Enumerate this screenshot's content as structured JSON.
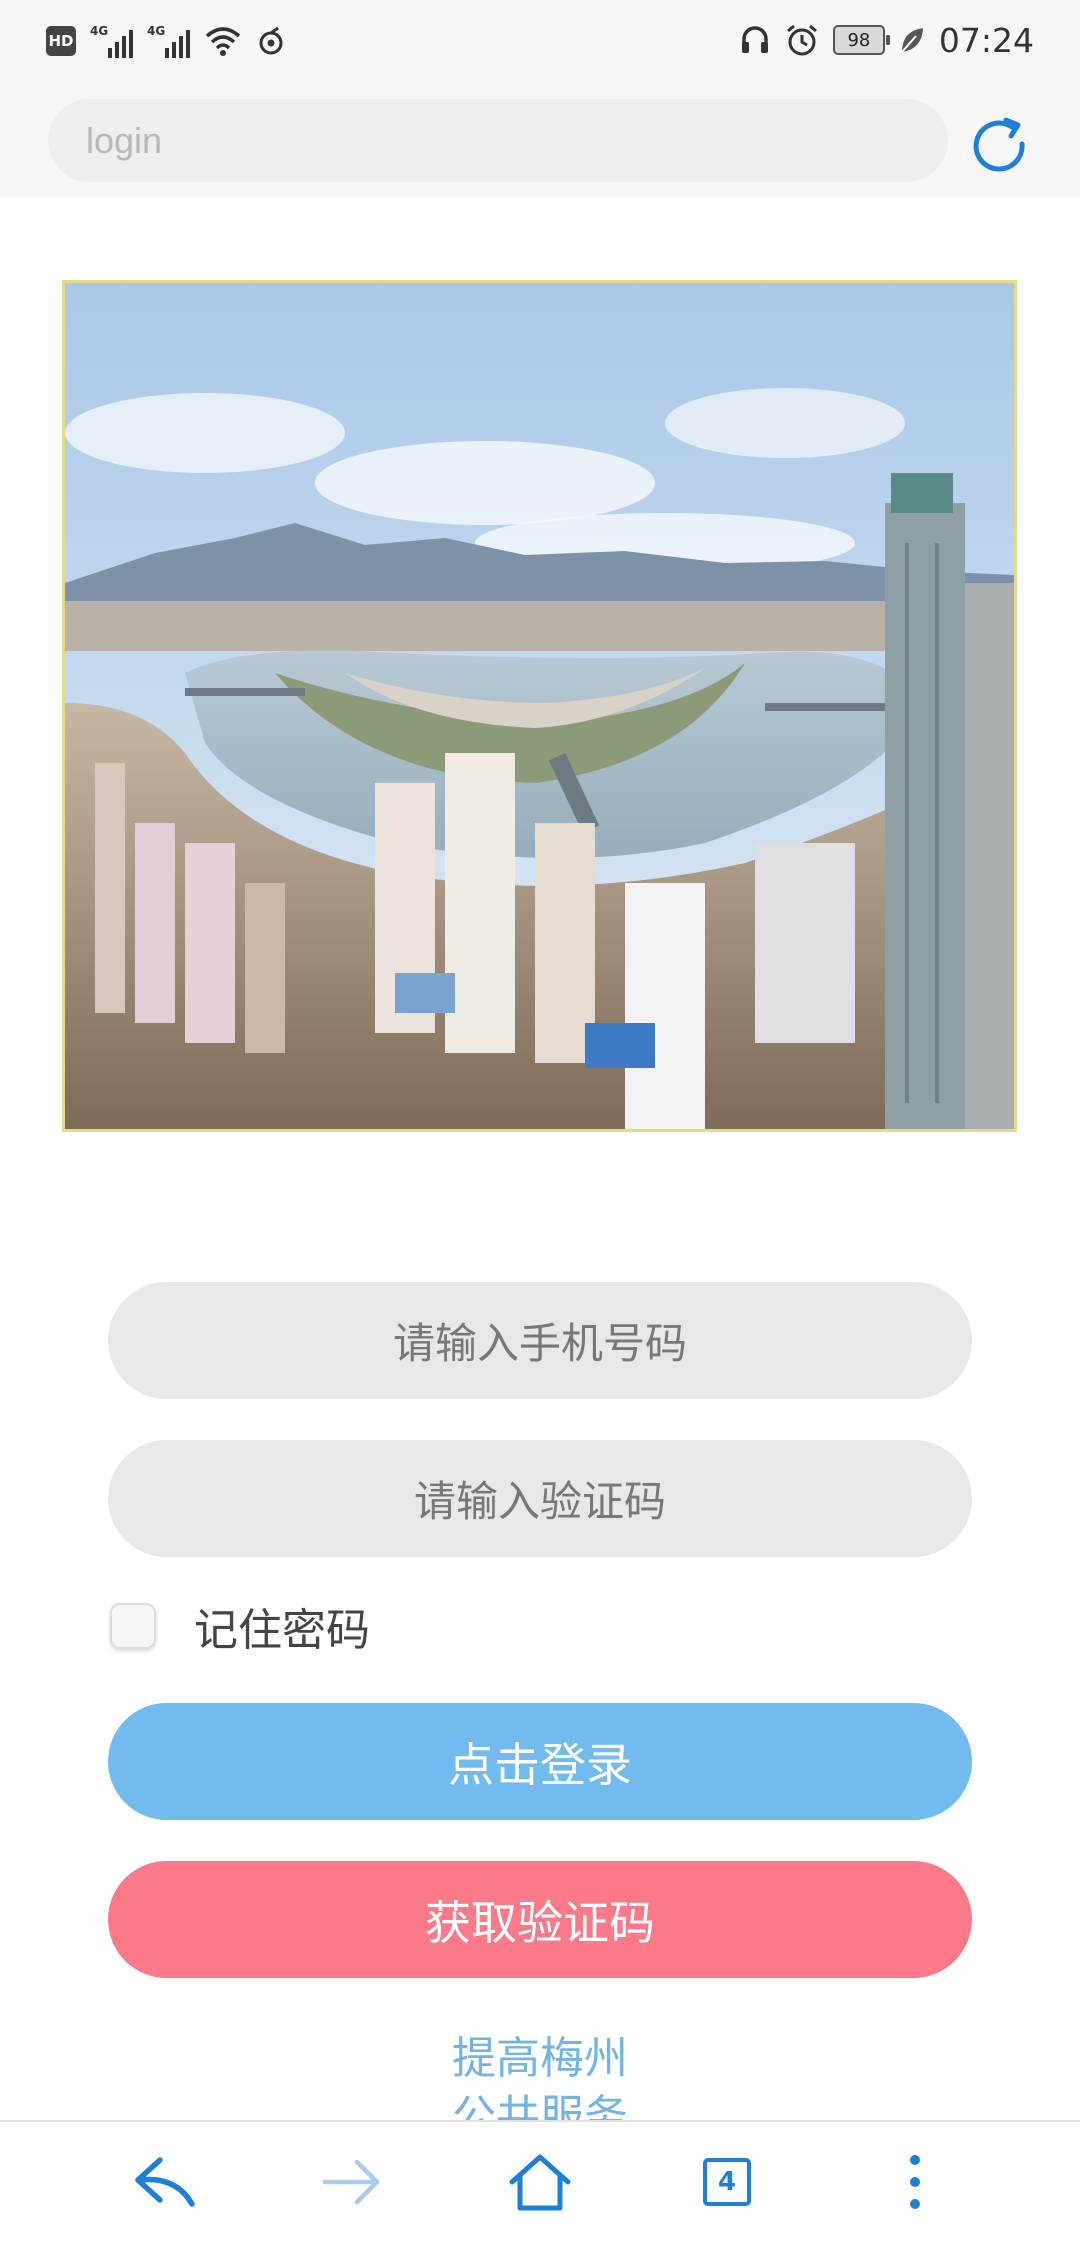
{
  "status_bar": {
    "hd_label": "HD",
    "network_1": "4G",
    "network_2": "4G",
    "battery_level": "98",
    "time": "07:24"
  },
  "browser": {
    "url_placeholder": "login",
    "reload_icon": "reload-icon",
    "accent_color": "#1d7fd8"
  },
  "hero_image": {
    "description_icon": "city-river-panorama-image"
  },
  "form": {
    "phone_placeholder": "请输入手机号码",
    "code_placeholder": "请输入验证码",
    "remember_label": "记住密码",
    "remember_checked": false,
    "login_button": "点击登录",
    "get_code_button": "获取验证码",
    "login_color": "#72bbee",
    "get_code_color": "#fb7a89"
  },
  "footer": {
    "link_line1": "提高梅州",
    "link_line2": "公共服务"
  },
  "bottom_nav": {
    "back_icon": "back-icon",
    "forward_icon": "forward-icon",
    "home_icon": "home-icon",
    "tab_count": "4",
    "menu_icon": "more-vertical-icon"
  }
}
